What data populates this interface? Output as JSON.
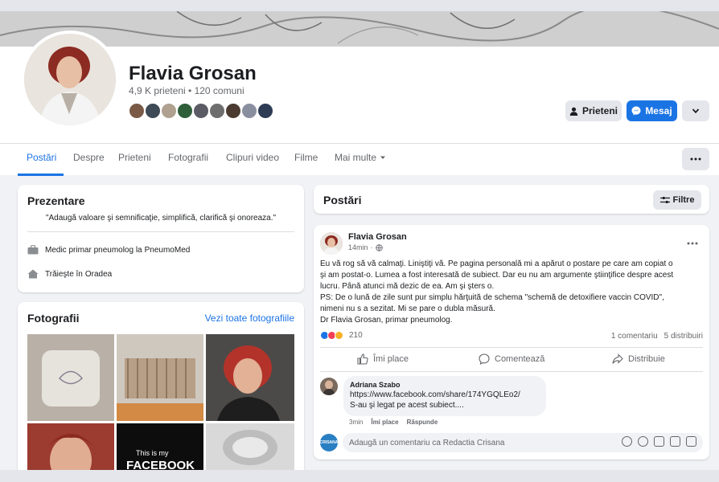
{
  "profile": {
    "name": "Flavia Grosan",
    "stats": "4,9 K prieteni • 120 comuni"
  },
  "actions": {
    "friends_label": "Prieteni",
    "message_label": "Mesaj"
  },
  "tabs": [
    {
      "label": "Postări"
    },
    {
      "label": "Despre"
    },
    {
      "label": "Prieteni"
    },
    {
      "label": "Fotografii"
    },
    {
      "label": "Clipuri video"
    },
    {
      "label": "Filme"
    },
    {
      "label": "Mai multe"
    }
  ],
  "intro": {
    "title": "Prezentare",
    "bio": "\"Adaugă valoare şi semnificaţie, simplifică, clarifică şi onoreaza.\"",
    "work_prefix": "Medic primar pneumolog la",
    "work_place": "PneumoMed",
    "home_prefix": "Trăieşte în",
    "home_city": "Oradea"
  },
  "photos": {
    "title": "Fotografii",
    "see_all": "Vezi toate fotografiile",
    "caption_line1": "This is my",
    "caption_line2": "FACEBOOK"
  },
  "posts_header": {
    "title": "Postări",
    "filter_label": "Filtre"
  },
  "post": {
    "author": "Flavia Grosan",
    "time": "14min",
    "lines": [
      "Eu vă rog să vă calmaţi. Liniştiţi vă. Pe pagina personală mi a apărut o postare pe care am copiat o",
      "şi am postat-o. Lumea a fost interesată de subiect. Dar eu nu am argumente ştiinţifice despre acest",
      "lucru. Până atunci mă dezic de ea. Am şi şters o.",
      "PS: De o lună de zile sunt pur simplu hărţuită de schema \"schemă de detoxifiere vaccin COVID\",",
      "nimeni nu s a sezitat. Mi se pare o dubla măsură.",
      "Dr Flavia Grosan, primar pneumolog."
    ],
    "reaction_count": "210",
    "comments_count": "1 comentariu",
    "shares_count": "5 distribuiri",
    "like_label": "Îmi place",
    "comment_label": "Comentează",
    "share_label": "Distribuie"
  },
  "comment": {
    "author": "Adriana Szabo",
    "link": "https://www.facebook.com/share/174YGQLEo2/",
    "text": "S-au şi legat pe acest subiect....",
    "time": "3min",
    "like": "Îmi place",
    "reply": "Răspunde"
  },
  "write_comment": {
    "avatar_text": "CRISANA",
    "placeholder": "Adaugă un comentariu ca Redactia Crisana"
  }
}
